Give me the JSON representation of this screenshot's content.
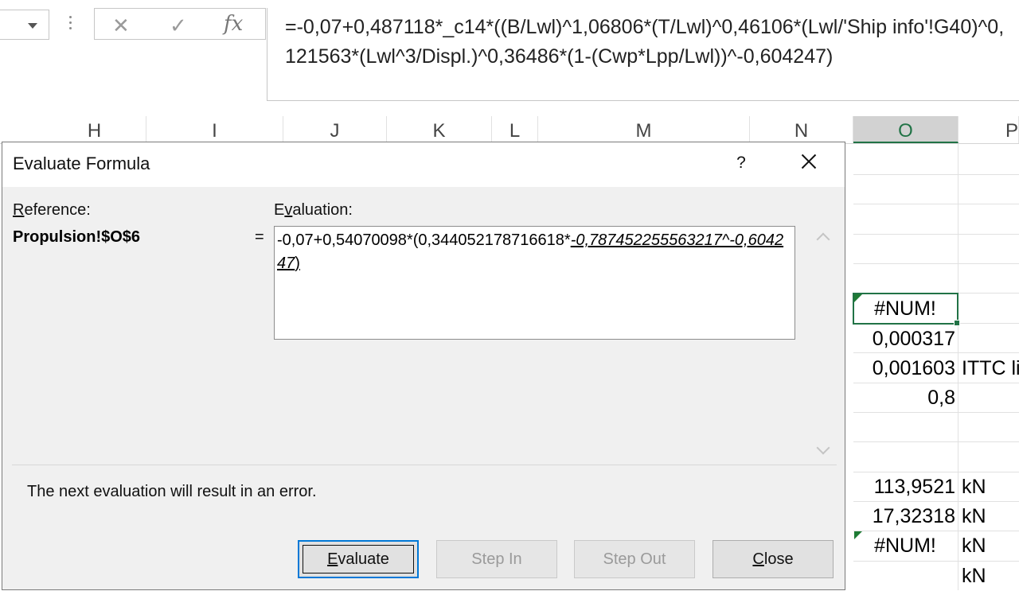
{
  "formula_bar": {
    "formula": "=-0,07+0,487118*_c14*((B/Lwl)^1,06806*(T/Lwl)^0,46106*(Lwl/'Ship info'!G40)^0,121563*(Lwl^3/Displ.)^0,36486*(1-(Cwp*Lpp/Lwl))^-0,604247)",
    "cancel_glyph": "✕",
    "enter_glyph": "✓",
    "fx_glyph": "fx"
  },
  "columns": [
    "H",
    "I",
    "J",
    "K",
    "L",
    "M",
    "N",
    "O",
    "P"
  ],
  "selected_column": "O",
  "cells": {
    "o6": "#NUM!",
    "o7": "0,000317",
    "o8": "0,001603",
    "p8": "ITTC li",
    "o9": "0,8",
    "o12": "113,9521",
    "p12": "kN",
    "o13": "17,32318",
    "p13": "kN",
    "o14": "#NUM!",
    "p14": "kN",
    "p15": "kN"
  },
  "dialog": {
    "title": "Evaluate Formula",
    "help": "?",
    "reference_label_u": "R",
    "reference_label_rest": "eference:",
    "evaluation_label_pre": "E",
    "evaluation_label_u": "v",
    "evaluation_label_rest": "aluation:",
    "reference_value": "Propulsion!$O$6",
    "equals": "=",
    "evaluation_prefix": "-0,07+0,54070098*(0,344052178716618*",
    "evaluation_highlight": "-0,787452255563217^-0,604247",
    "evaluation_suffix": ")",
    "message": "The next evaluation will result in an error.",
    "buttons": {
      "evaluate_u": "E",
      "evaluate_rest": "valuate",
      "step_in": "Step In",
      "step_out": "Step Out",
      "close_u": "C",
      "close_rest": "lose"
    }
  }
}
